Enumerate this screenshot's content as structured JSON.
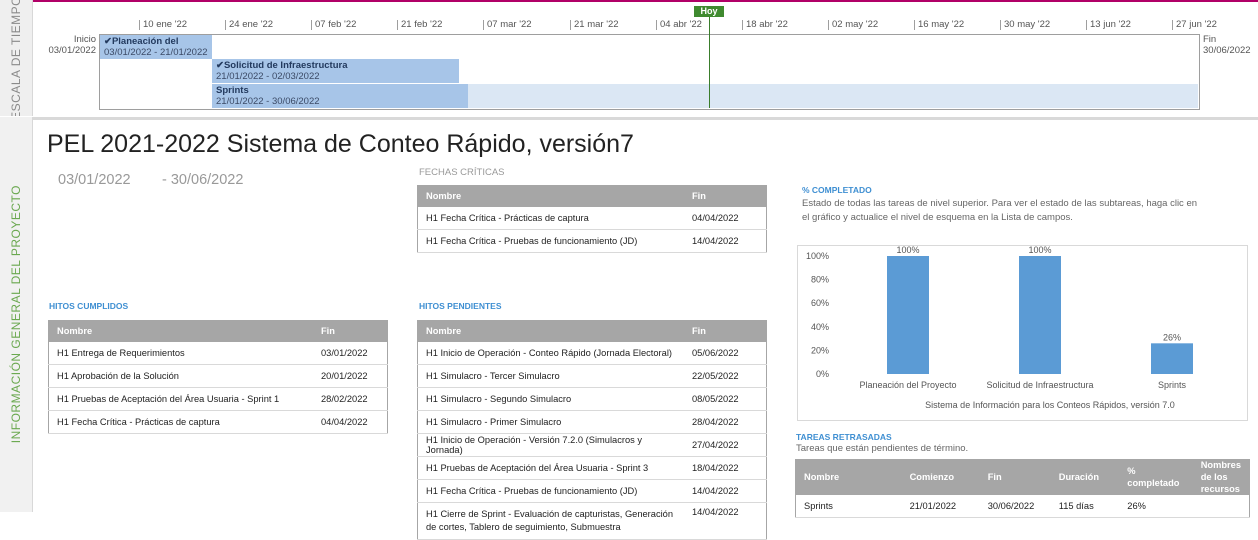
{
  "side_bands": {
    "time": "ESCALA DE TIEMPO",
    "info": "INFORMACIÓN GENERAL DEL PROYECTO"
  },
  "timeline": {
    "start_label": "Inicio",
    "start_date": "03/01/2022",
    "end_label": "Fin",
    "end_date": "30/06/2022",
    "today_label": "Hoy",
    "ticks": [
      "10 ene '22",
      "24 ene '22",
      "07 feb '22",
      "21 feb '22",
      "07 mar '22",
      "21 mar '22",
      "04 abr '22",
      "18 abr '22",
      "02 may '22",
      "16 may '22",
      "30 may '22",
      "13 jun '22",
      "27 jun '22"
    ],
    "bars": [
      {
        "title": "✔Planeación del",
        "dates": "03/01/2022 - 21/01/2022"
      },
      {
        "title": "✔Solicitud de Infraestructura",
        "dates": "21/01/2022 - 02/03/2022"
      },
      {
        "title": "Sprints",
        "dates": "21/01/2022 - 30/06/2022"
      }
    ],
    "colors": {
      "bar": "#a7c5e8",
      "bar_light": "#dbe7f4",
      "today": "#3f8a2f"
    }
  },
  "project": {
    "title": "PEL 2021-2022 Sistema de Conteo Rápido, versión7",
    "start": "03/01/2022",
    "end": "- 30/06/2022"
  },
  "fechas_criticas": {
    "label": "FECHAS CRÍTICAS",
    "headers": [
      "Nombre",
      "Fin"
    ],
    "rows": [
      [
        "H1 Fecha Crítica - Prácticas de captura",
        "04/04/2022"
      ],
      [
        "H1 Fecha Crítica - Pruebas de funcionamiento (JD)",
        "14/04/2022"
      ]
    ]
  },
  "hitos_cumplidos": {
    "label": "HITOS CUMPLIDOS",
    "headers": [
      "Nombre",
      "Fin"
    ],
    "rows": [
      [
        "H1 Entrega de Requerimientos",
        "03/01/2022"
      ],
      [
        "H1 Aprobación de la Solución",
        "20/01/2022"
      ],
      [
        "H1 Pruebas de Aceptación del Área Usuaria - Sprint 1",
        "28/02/2022"
      ],
      [
        "H1 Fecha Crítica - Prácticas de captura",
        "04/04/2022"
      ]
    ]
  },
  "hitos_pendientes": {
    "label": "HITOS PENDIENTES",
    "headers": [
      "Nombre",
      "Fin"
    ],
    "rows": [
      [
        "H1 Inicio de Operación - Conteo Rápido (Jornada Electoral)",
        "05/06/2022"
      ],
      [
        "H1 Simulacro - Tercer Simulacro",
        "22/05/2022"
      ],
      [
        "H1 Simulacro - Segundo Simulacro",
        "08/05/2022"
      ],
      [
        "H1 Simulacro - Primer Simulacro",
        "28/04/2022"
      ],
      [
        "H1 Inicio de Operación - Versión 7.2.0 (Simulacros y Jornada)",
        "27/04/2022"
      ],
      [
        "H1 Pruebas de Aceptación del Área Usuaria - Sprint 3",
        "18/04/2022"
      ],
      [
        "H1 Fecha Crítica - Pruebas de funcionamiento (JD)",
        "14/04/2022"
      ],
      [
        "H1 Cierre de Sprint - Evaluación de capturistas, Generación de cortes, Tablero de seguimiento, Submuestra",
        "14/04/2022"
      ]
    ]
  },
  "completado": {
    "label": "% COMPLETADO",
    "note": "Estado de todas las tareas de nivel superior. Para ver el estado de las subtareas, haga clic en el gráfico y actualice el nivel de esquema en la Lista de campos."
  },
  "chart_data": {
    "type": "bar",
    "categories": [
      "Planeación del Proyecto",
      "Solicitud de Infraestructura",
      "Sprints"
    ],
    "values": [
      100,
      100,
      26
    ],
    "value_labels": [
      "100%",
      "100%",
      "26%"
    ],
    "xlabel": "Sistema de Información para los Conteos Rápidos, versión 7.0",
    "ylabel": "",
    "ylim": [
      0,
      100
    ],
    "yticks": [
      "0%",
      "20%",
      "40%",
      "60%",
      "80%",
      "100%"
    ],
    "grid": false,
    "color": "#5b9bd5"
  },
  "tareas_retrasadas": {
    "label": "TAREAS RETRASADAS",
    "note": "Tareas que están pendientes de término.",
    "headers": [
      "Nombre",
      "Comienzo",
      "Fin",
      "Duración",
      "% completado",
      "Nombres de los recursos"
    ],
    "rows": [
      [
        "Sprints",
        "21/01/2022",
        "30/06/2022",
        "115 días",
        "26%",
        ""
      ]
    ]
  }
}
